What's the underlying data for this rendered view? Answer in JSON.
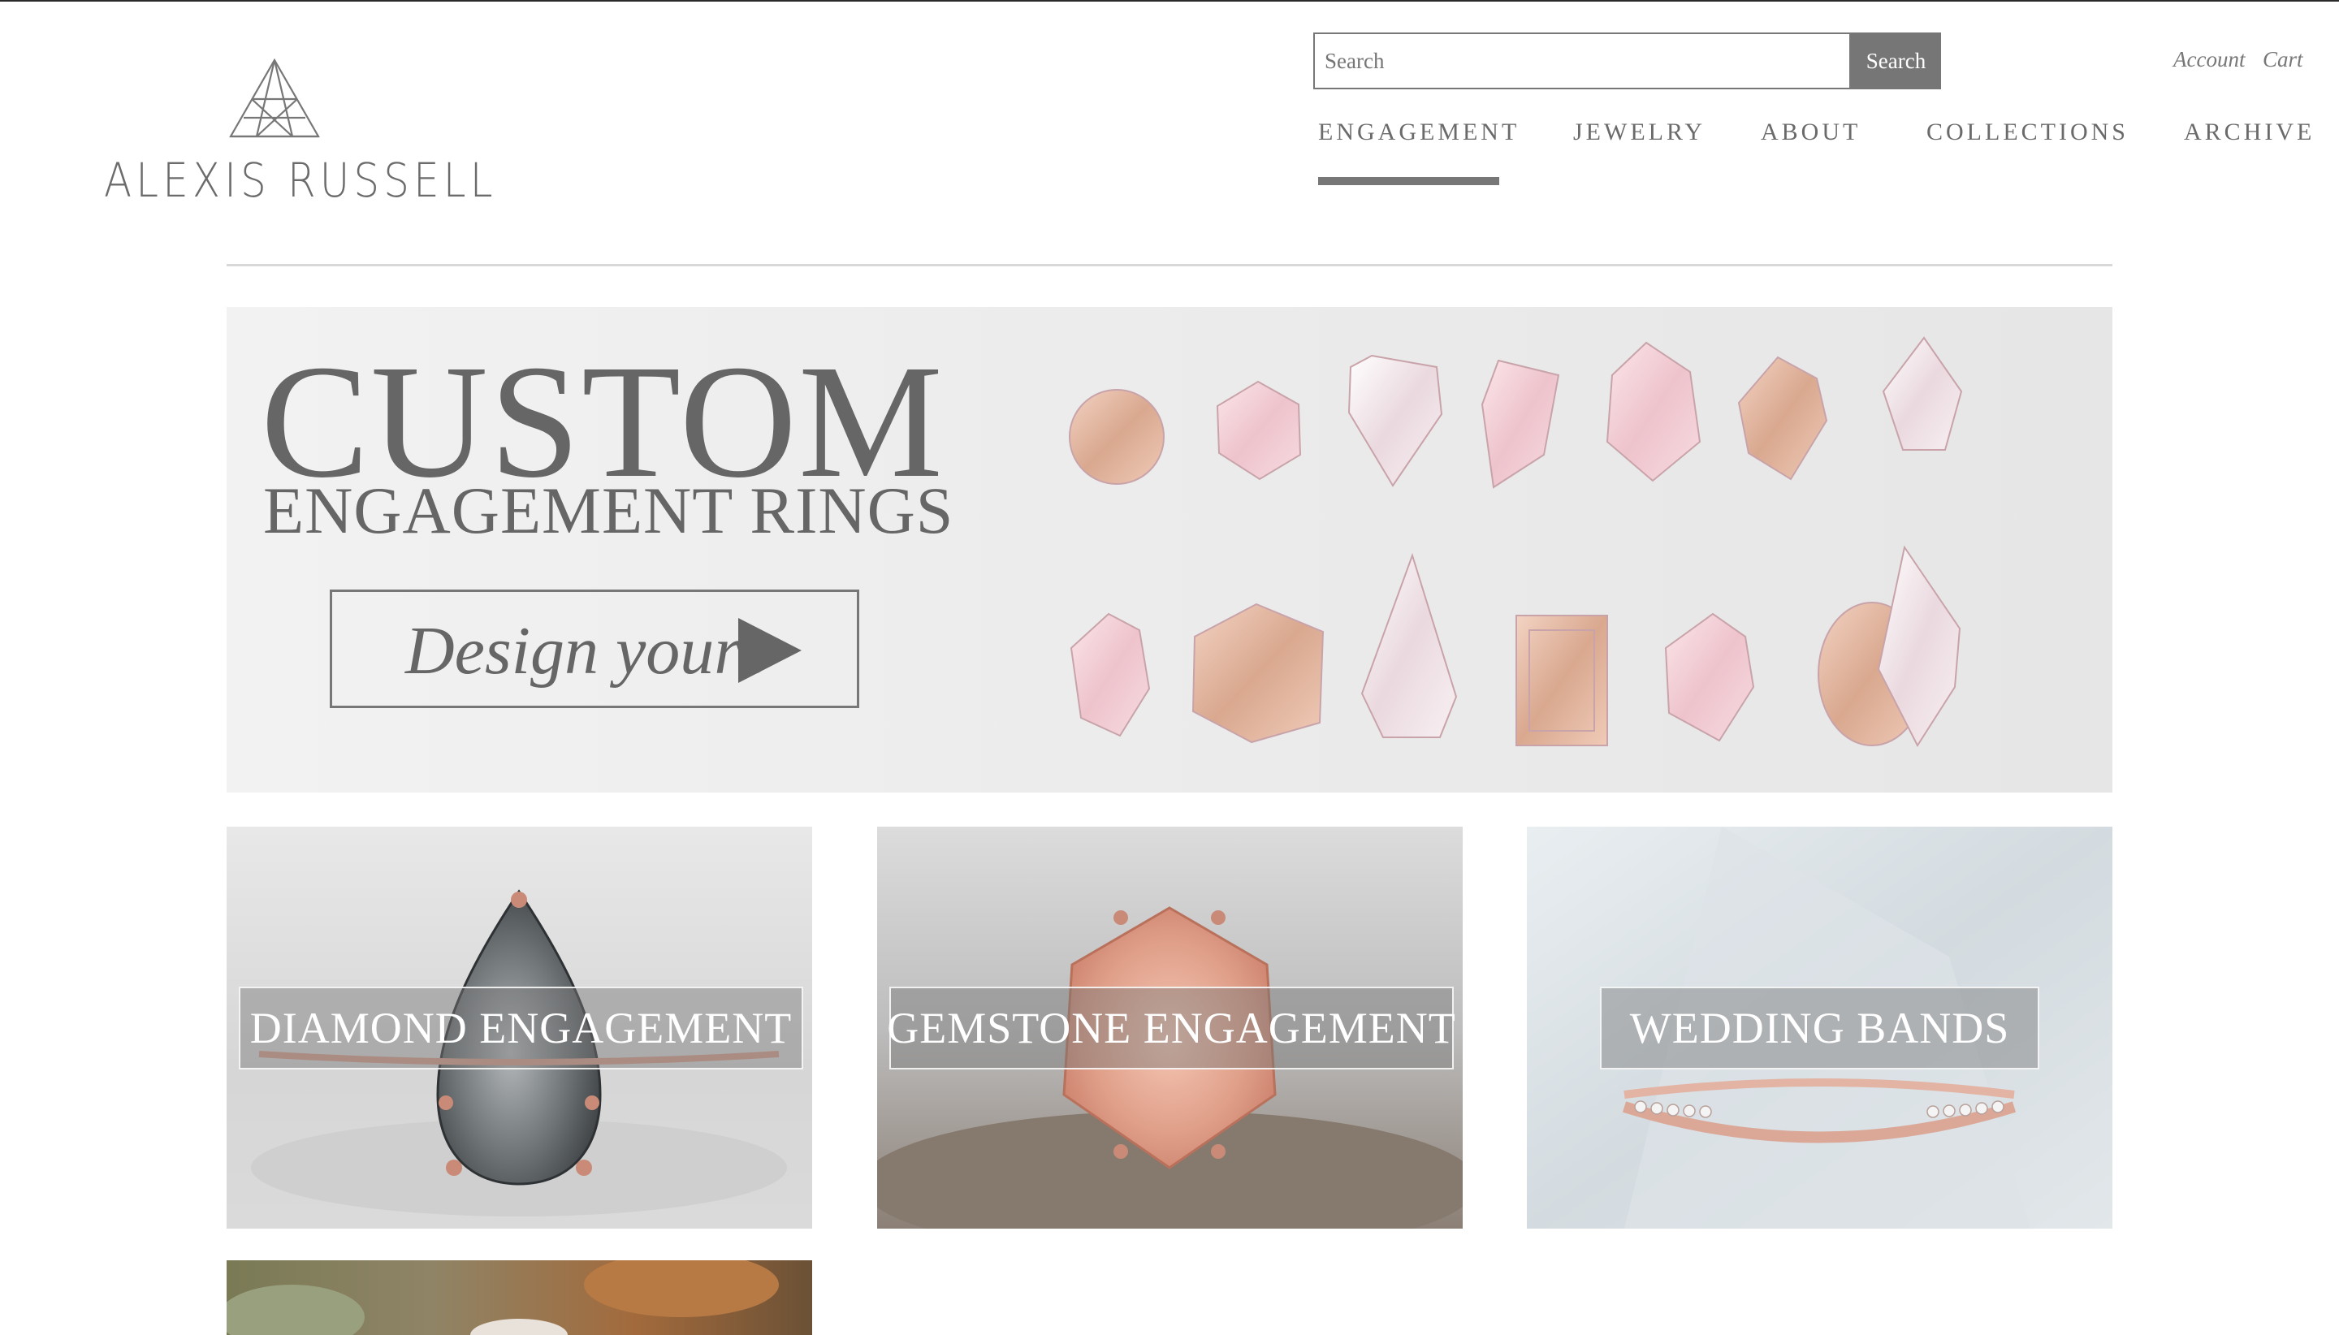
{
  "brand": {
    "name": "ALEXIS RUSSELL"
  },
  "search": {
    "placeholder": "Search",
    "button_label": "Search"
  },
  "utility_nav": {
    "account_label": "Account",
    "cart_label": "Cart"
  },
  "main_nav": {
    "items": [
      {
        "label": "ENGAGEMENT",
        "active": true
      },
      {
        "label": "JEWELRY"
      },
      {
        "label": "ABOUT"
      },
      {
        "label": "COLLECTIONS"
      },
      {
        "label": "ARCHIVE"
      }
    ]
  },
  "hero": {
    "title": "CUSTOM",
    "subtitle": "ENGAGEMENT RINGS",
    "cta_label": "Design yours"
  },
  "categories": [
    {
      "label": "DIAMOND ENGAGEMENT"
    },
    {
      "label": "GEMSTONE ENGAGEMENT"
    },
    {
      "label": "WEDDING BANDS"
    }
  ],
  "colors": {
    "accent": "#767676",
    "text": "#6a6a6a",
    "gem_pink": "#f1c9d2",
    "gem_peach": "#e8b9a4",
    "rose_gold": "#d99a8a"
  }
}
